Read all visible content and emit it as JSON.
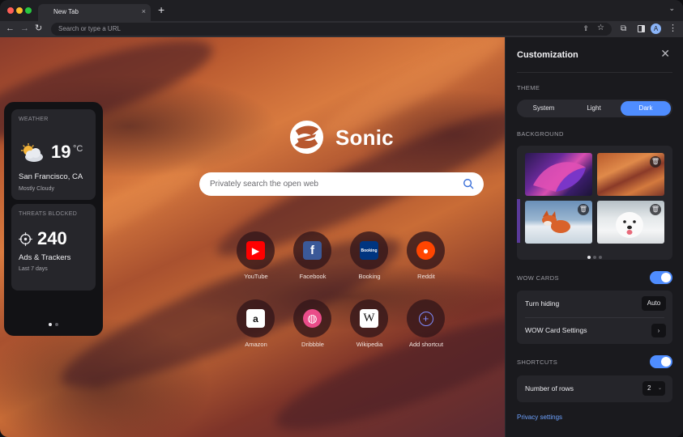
{
  "browser": {
    "tab_title": "New Tab",
    "tab_close": "×",
    "new_tab": "+",
    "omnibox_placeholder": "Search or type a URL",
    "profile_initial": "A"
  },
  "page": {
    "logo_text": "Sonic",
    "search_placeholder": "Privately search the open web",
    "shortcuts": [
      {
        "label": "YouTube",
        "icon": "youtube-icon",
        "glyph": "▶",
        "bg": "#ff0000",
        "fg": "#ffffff"
      },
      {
        "label": "Facebook",
        "icon": "facebook-icon",
        "glyph": "f",
        "bg": "#3b5998",
        "fg": "#ffffff"
      },
      {
        "label": "Booking",
        "icon": "booking-icon",
        "glyph": "Booking",
        "bg": "#003580",
        "fg": "#ffffff"
      },
      {
        "label": "Reddit",
        "icon": "reddit-icon",
        "glyph": "●",
        "bg": "#ff4500",
        "fg": "#ffffff"
      },
      {
        "label": "Amazon",
        "icon": "amazon-icon",
        "glyph": "a",
        "bg": "#ffffff",
        "fg": "#111111"
      },
      {
        "label": "Dribbble",
        "icon": "dribbble-icon",
        "glyph": "◍",
        "bg": "#ea4c89",
        "fg": "#ffffff"
      },
      {
        "label": "Wikipedia",
        "icon": "wikipedia-icon",
        "glyph": "W",
        "bg": "#ffffff",
        "fg": "#111111"
      },
      {
        "label": "Add shortcut",
        "icon": "add-shortcut-icon",
        "glyph": "+",
        "bg": "transparent",
        "fg": "#7f8cff"
      }
    ]
  },
  "widgets": {
    "weather": {
      "heading": "WEATHER",
      "temp": "19",
      "unit": "°C",
      "city": "San Francisco, CA",
      "condition": "Mostly Cloudy",
      "icon": "partly-cloudy-icon"
    },
    "threats": {
      "heading": "THREATS BLOCKED",
      "count": "240",
      "label": "Ads & Trackers",
      "period": "Last 7 days",
      "icon": "crosshair-icon"
    }
  },
  "customization": {
    "title": "Customization",
    "close": "✕",
    "theme": {
      "heading": "THEME",
      "options": [
        "System",
        "Light",
        "Dark"
      ],
      "selected": "Dark"
    },
    "background": {
      "heading": "BACKGROUND",
      "thumbnails": [
        "abstract-purple",
        "desert-dunes",
        "red-fox",
        "white-dog"
      ]
    },
    "wow_cards": {
      "heading": "WOW CARDS",
      "enabled": true,
      "turn_hiding_label": "Turn hiding",
      "turn_hiding_value": "Auto",
      "settings_label": "WOW Card Settings",
      "settings_chevron": "›"
    },
    "shortcuts": {
      "heading": "SHORTCUTS",
      "enabled": true,
      "rows_label": "Number of rows",
      "rows_value": "2",
      "rows_caret": "⌄"
    },
    "privacy_link": "Privacy settings"
  },
  "colors": {
    "accent": "#4f8dff",
    "panel_bg": "#1a1a1e",
    "link": "#6da2ff"
  }
}
